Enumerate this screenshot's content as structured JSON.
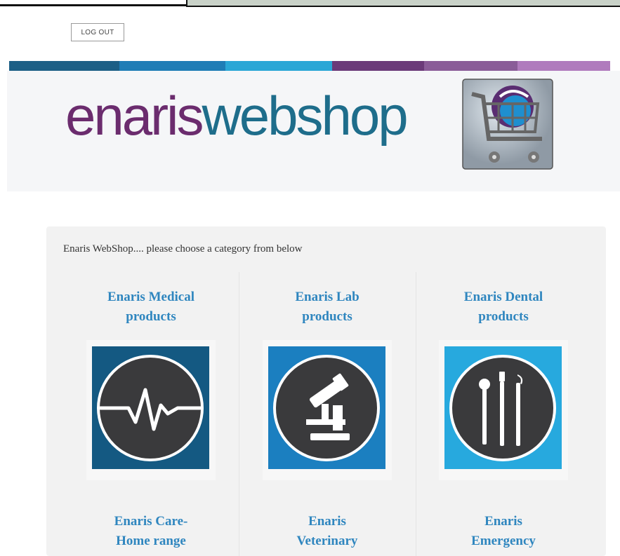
{
  "header": {
    "logout_label": "LOG OUT",
    "logo": {
      "part1": "enaris",
      "part2": "webshop"
    },
    "stripe_colors": [
      "#1c5f86",
      "#1f7db6",
      "#2aa7d6",
      "#6b3a79",
      "#8a5c98",
      "#b07bbd"
    ]
  },
  "main": {
    "intro": "Enaris WebShop.... please choose a category from below",
    "categories": [
      {
        "line1": "Enaris Medical",
        "line2": "products",
        "icon": "heartbeat-icon",
        "color": "#145982"
      },
      {
        "line1": "Enaris Lab",
        "line2": "products",
        "icon": "microscope-icon",
        "color": "#1b7fc0"
      },
      {
        "line1": "Enaris Dental",
        "line2": "products",
        "icon": "dental-tools-icon",
        "color": "#27a9de"
      },
      {
        "line1": "Enaris Care-",
        "line2": "Home range"
      },
      {
        "line1": "Enaris",
        "line2": "Veterinary"
      },
      {
        "line1": "Enaris",
        "line2": "Emergency"
      }
    ]
  }
}
